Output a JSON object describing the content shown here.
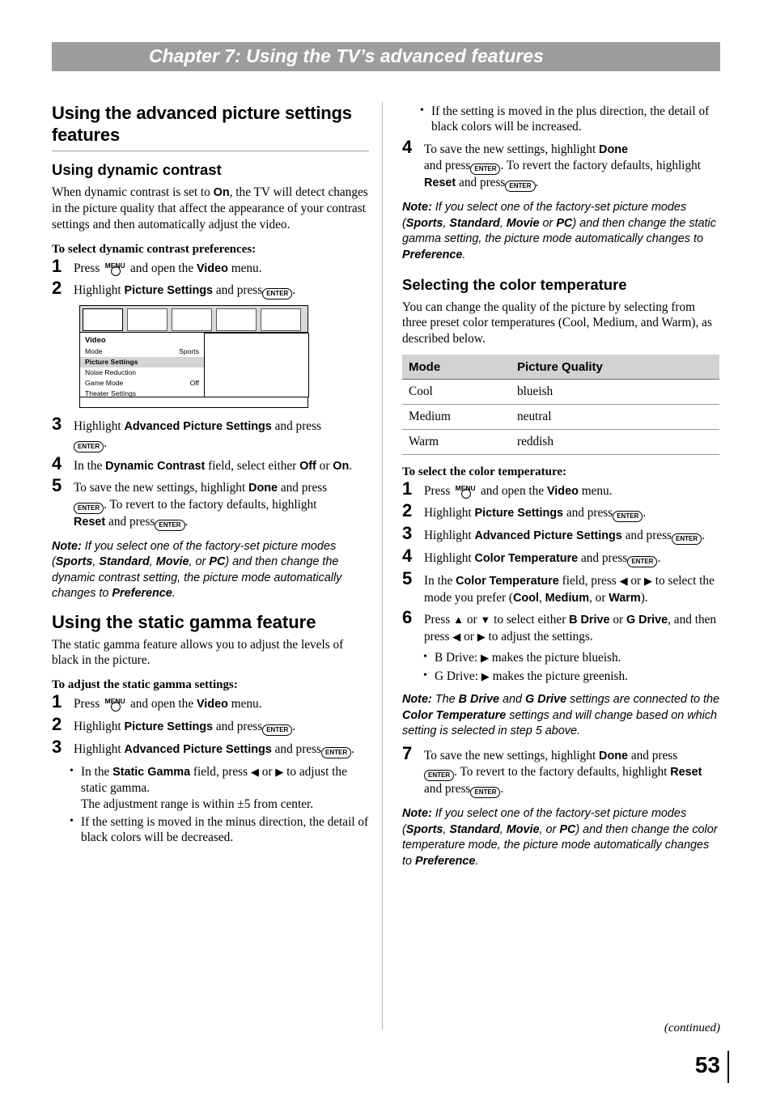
{
  "chapter": {
    "title": "Chapter 7: Using the TV’s advanced features"
  },
  "left": {
    "heading": "Using the advanced picture settings features",
    "dynamic": {
      "heading": "Using dynamic contrast",
      "intro": "When dynamic contrast is set to ",
      "intro_bold": "On",
      "intro_rest": ", the TV will detect changes in the picture quality that affect the appearance of your contrast settings and then automatically adjust the video.",
      "subheading": "To select dynamic contrast preferences:",
      "step1_a": "Press",
      "step1_b": "and open the",
      "step1_bold": "Video",
      "step1_c": "menu.",
      "step2_a": "Highlight",
      "step2_bold": "Picture Settings",
      "step2_b": "and press",
      "step3_a": "Highlight",
      "step3_bold": "Advanced Picture Settings",
      "step3_b": "and press",
      "step4_a": "In the",
      "step4_bold": "Dynamic Contrast",
      "step4_b": "field, select either",
      "step4_bold2": "Off",
      "step4_or": "or",
      "step4_bold3": "On",
      "step4_end": ".",
      "step5_a": "To save the new settings, highlight",
      "step5_bold": "Done",
      "step5_b": "and press",
      "step5_c": ". To revert to the factory defaults, highlight",
      "step5_bold2": "Reset",
      "step5_d": "and press"
    },
    "figure": {
      "title": "Video",
      "rows": [
        {
          "label": "Mode",
          "value": "Sports",
          "highlight": false
        },
        {
          "label": "Picture Settings",
          "value": "",
          "highlight": true
        },
        {
          "label": "Noise Reduction",
          "value": "",
          "highlight": false
        },
        {
          "label": "Game Mode",
          "value": "Off",
          "highlight": false
        },
        {
          "label": "Theater Settings",
          "value": "",
          "highlight": false
        }
      ],
      "tabs": [
        "picture-tab",
        "audio-tab",
        "preferences-tab",
        "lock-tab",
        "setup-tab"
      ]
    },
    "note1": {
      "label": "Note:",
      "text_a": "If you select one of the factory-set picture modes (",
      "m1": "Sports",
      "m2": "Standard",
      "m3": "Movie",
      "m4": "PC",
      "text_b": ") and then change the dynamic contrast setting, the picture mode automatically changes to ",
      "pref": "Preference",
      "text_c": "."
    },
    "gamma": {
      "heading": "Using the static gamma feature",
      "intro": "The static gamma feature allows you to adjust the levels of black in the picture.",
      "subheading": "To adjust the static gamma settings:",
      "step1_a": "Press",
      "step1_b": "and open the",
      "step1_bold": "Video",
      "step1_c": "menu.",
      "step2_a": "Highlight",
      "step2_bold": "Picture Settings",
      "step2_b": "and press",
      "step3_a": "Highlight",
      "step3_bold": "Advanced Picture Settings",
      "step3_b": "and press",
      "bullet1_a": "In the",
      "bullet1_bold": "Static Gamma",
      "bullet1_b": "field, press",
      "bullet1_c": "or",
      "bullet1_d": "to adjust the static gamma.",
      "bullet1_e": "The adjustment range is within ±5 from center.",
      "bullet2": "If the setting is moved in the minus direction, the detail of black colors will be decreased."
    }
  },
  "right": {
    "bullet_top": "If the setting is moved in the plus direction, the detail of black colors will be increased.",
    "step4_a": "To save the new settings, highlight",
    "step4_bold": "Done",
    "step4_b": "and press",
    "step4_c": ". To revert the factory defaults, highlight",
    "step4_bold2": "Reset",
    "step4_d": "and press",
    "note1": {
      "label": "Note:",
      "text_a": "If you select one of the factory-set picture modes (",
      "m1": "Sports",
      "m2": "Standard",
      "m3": "Movie",
      "m4": "PC",
      "text_b": ") and then change the static gamma setting, the picture mode automatically changes to ",
      "pref": "Preference",
      "text_c": "."
    },
    "color": {
      "heading": "Selecting the color temperature",
      "intro": "You can change the quality of the picture by selecting from three preset color temperatures (Cool, Medium, and Warm), as described below.",
      "table": {
        "headers": [
          "Mode",
          "Picture Quality"
        ],
        "rows": [
          [
            "Cool",
            "blueish"
          ],
          [
            "Medium",
            "neutral"
          ],
          [
            "Warm",
            "reddish"
          ]
        ]
      },
      "subheading": "To select the color temperature:",
      "step1_a": "Press",
      "step1_b": "and open the",
      "step1_bold": "Video",
      "step1_c": "menu.",
      "step2_a": "Highlight",
      "step2_bold": "Picture Settings",
      "step2_b": "and press",
      "step3_a": "Highlight",
      "step3_bold": "Advanced Picture Settings",
      "step3_b": "and press",
      "step4_a": "Highlight",
      "step4_bold": "Color Temperature",
      "step4_b": "and press",
      "step5_a": "In the",
      "step5_bold": "Color Temperature",
      "step5_b": "field, press",
      "step5_c": "or",
      "step5_d": "to select the mode you prefer (",
      "step5_m1": "Cool",
      "step5_m2": "Medium",
      "step5_m3": "Warm",
      "step5_e": ").",
      "step6_a": "Press",
      "step6_b": "or",
      "step6_c": "to select either",
      "step6_bold1": "B Drive",
      "step6_or": "or",
      "step6_bold2": "G Drive",
      "step6_d": ", and then press",
      "step6_e": "or",
      "step6_f": "to adjust the settings.",
      "bullet1_a": "B Drive:",
      "bullet1_b": "makes the picture blueish.",
      "bullet2_a": "G Drive:",
      "bullet2_b": "makes the picture greenish.",
      "note2": {
        "label": "Note:",
        "text_a": "The ",
        "b1": "B Drive",
        "and": " and ",
        "b2": "G Drive",
        "text_b": " settings are connected to the ",
        "b3": "Color Temperature",
        "text_c": " settings and will change based on which setting is selected in step 5 above."
      },
      "step7_a": "To save the new settings, highlight",
      "step7_bold": "Done",
      "step7_b": "and press",
      "step7_c": ". To revert to the factory defaults, highlight",
      "step7_bold2": "Reset",
      "step7_d": "and press",
      "note3": {
        "label": "Note:",
        "text_a": "If you select one of the factory-set picture modes (",
        "m1": "Sports",
        "m2": "Standard",
        "m3": "Movie",
        "m4": "PC",
        "text_b": ") and then change the color temperature mode, the picture mode automatically changes to ",
        "pref": "Preference",
        "text_c": "."
      }
    }
  },
  "footer": {
    "continued": "(continued)",
    "page": "53"
  },
  "glyphs": {
    "enter": "ENTER",
    "menu": "MENU",
    "left_arrow": "◀",
    "right_arrow": "▶",
    "up_arrow": "▲",
    "down_arrow": "▼"
  }
}
